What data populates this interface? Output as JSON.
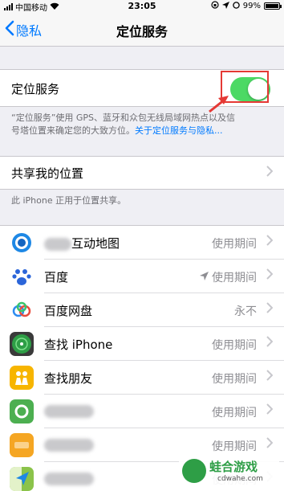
{
  "status_bar": {
    "carrier": "中国移动",
    "time": "23:05",
    "battery": "99%",
    "battery_level": 0.99
  },
  "nav": {
    "back_label": "隐私",
    "title": "定位服务"
  },
  "location_services": {
    "label": "定位服务",
    "enabled": true,
    "description_line1": "“定位服务”使用 GPS、蓝牙和众包无线局域网热点以及信",
    "description_line2": "号塔位置来确定您的大致方位。",
    "link": "关于定位服务与隐私..."
  },
  "share_location": {
    "label": "共享我的位置",
    "footer": "此 iPhone 正用于位置共享。"
  },
  "apps": [
    {
      "name": "互动地图",
      "value": "使用期间",
      "icon": "map-globe-icon",
      "name_blurred": true,
      "arrow": false
    },
    {
      "name": "百度",
      "value": "使用期间",
      "icon": "baidu-paw-icon",
      "name_blurred": false,
      "arrow": true
    },
    {
      "name": "百度网盘",
      "value": "永不",
      "icon": "baidu-cloud-icon",
      "name_blurred": false,
      "arrow": false
    },
    {
      "name": "查找 iPhone",
      "value": "使用期间",
      "icon": "find-iphone-radar-icon",
      "name_blurred": false,
      "arrow": false
    },
    {
      "name": "查找朋友",
      "value": "使用期间",
      "icon": "find-friends-icon",
      "name_blurred": false,
      "arrow": false
    },
    {
      "name": "",
      "value": "使用期间",
      "icon": "green-app-icon",
      "name_blurred": true,
      "arrow": false
    },
    {
      "name": "",
      "value": "使用期间",
      "icon": "orange-app-icon",
      "name_blurred": true,
      "arrow": false
    },
    {
      "name": "",
      "value": "使用期间",
      "icon": "maps-app-icon",
      "name_blurred": true,
      "arrow": false
    }
  ],
  "watermark": {
    "name": "蛙合游戏",
    "url": "cdwahe.com"
  },
  "colors": {
    "accent": "#007aff",
    "toggle_on": "#4cd964",
    "highlight": "#e53935"
  }
}
